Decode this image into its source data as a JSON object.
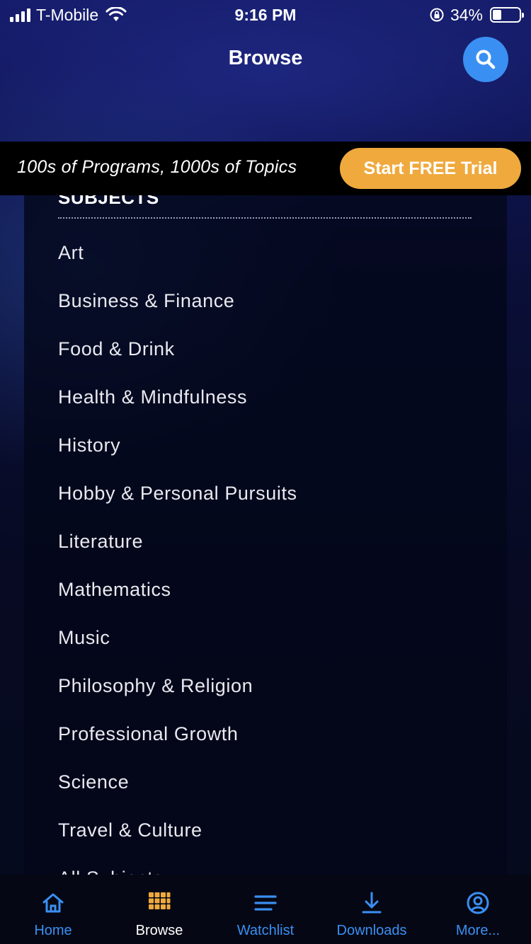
{
  "status_bar": {
    "carrier": "T-Mobile",
    "time": "9:16 PM",
    "battery": "34%"
  },
  "header": {
    "title": "Browse",
    "search_icon": "search-icon"
  },
  "promo": {
    "text": "100s of Programs, 1000s of Topics",
    "button_label": "Start FREE Trial"
  },
  "subjects": {
    "heading": "SUBJECTS",
    "items": [
      {
        "label": "Art"
      },
      {
        "label": "Business & Finance"
      },
      {
        "label": "Food & Drink"
      },
      {
        "label": "Health & Mindfulness"
      },
      {
        "label": "History"
      },
      {
        "label": "Hobby & Personal Pursuits"
      },
      {
        "label": "Literature"
      },
      {
        "label": "Mathematics"
      },
      {
        "label": "Music"
      },
      {
        "label": "Philosophy & Religion"
      },
      {
        "label": "Professional Growth"
      },
      {
        "label": "Science"
      },
      {
        "label": "Travel & Culture"
      },
      {
        "label": "All Subjects"
      }
    ]
  },
  "tabs": [
    {
      "label": "Home",
      "icon": "home-icon"
    },
    {
      "label": "Browse",
      "icon": "grid-icon"
    },
    {
      "label": "Watchlist",
      "icon": "list-icon"
    },
    {
      "label": "Downloads",
      "icon": "download-icon"
    },
    {
      "label": "More...",
      "icon": "user-circle-icon"
    }
  ],
  "colors": {
    "accent": "#3a8ff2",
    "trial_button": "#efa93d",
    "browse_icon": "#efa93d",
    "background": "#060a1f"
  }
}
